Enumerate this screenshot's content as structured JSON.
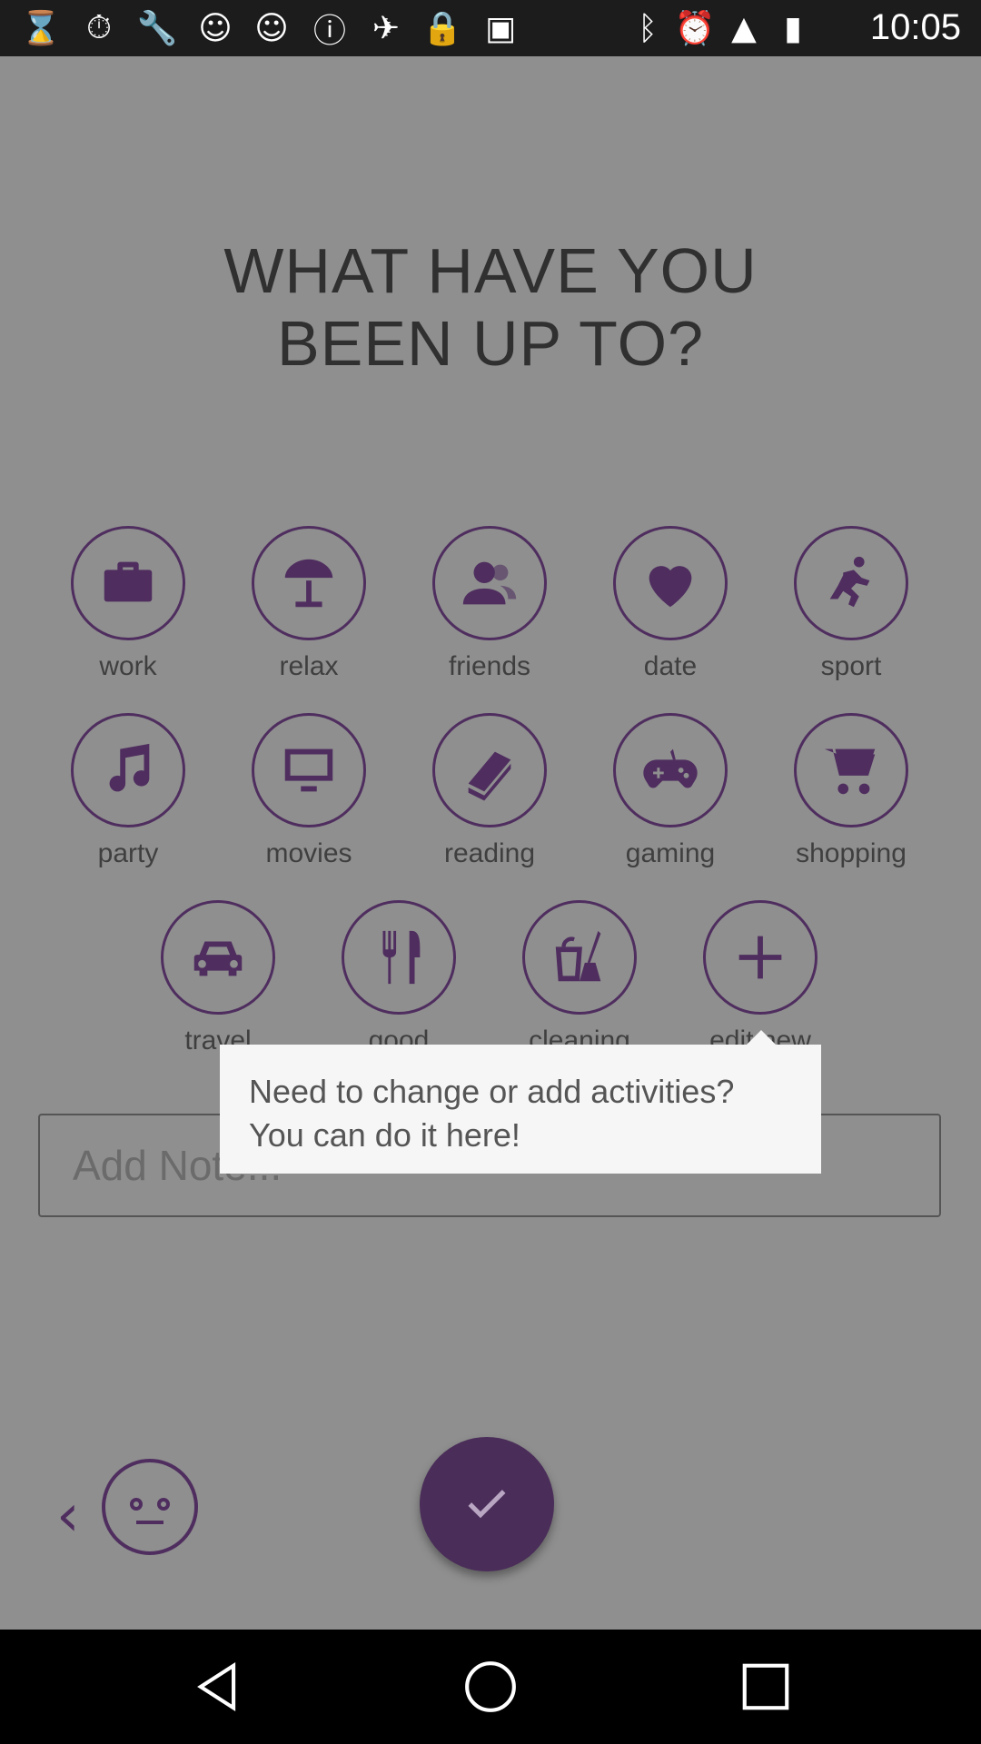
{
  "status_bar": {
    "time": "10:05",
    "icons": [
      "hourglass-icon",
      "stopwatch-icon",
      "wrench-icon",
      "smiley-icon",
      "smiley-icon",
      "info-icon",
      "satellite-icon",
      "lock-icon",
      "android-icon",
      "bluetooth-icon",
      "alarm-icon",
      "signal-icon",
      "battery-icon"
    ]
  },
  "title": {
    "line1": "WHAT HAVE YOU",
    "line2": "BEEN UP TO?"
  },
  "activities": [
    {
      "label": "work",
      "icon": "briefcase-icon"
    },
    {
      "label": "relax",
      "icon": "umbrella-icon"
    },
    {
      "label": "friends",
      "icon": "friends-icon"
    },
    {
      "label": "date",
      "icon": "heart-icon"
    },
    {
      "label": "sport",
      "icon": "runner-icon"
    },
    {
      "label": "party",
      "icon": "music-note-icon"
    },
    {
      "label": "movies",
      "icon": "monitor-icon"
    },
    {
      "label": "reading",
      "icon": "book-icon"
    },
    {
      "label": "gaming",
      "icon": "gamepad-icon"
    },
    {
      "label": "shopping",
      "icon": "cart-icon"
    },
    {
      "label": "travel",
      "icon": "car-icon"
    },
    {
      "label": "good meal",
      "icon": "cutlery-icon"
    },
    {
      "label": "cleaning",
      "icon": "cleaning-icon"
    },
    {
      "label": "edit new",
      "icon": "plus-icon"
    }
  ],
  "note": {
    "placeholder": "Add Note..."
  },
  "tooltip": {
    "line1": "Need to change or add activities?",
    "line2": "You can do it here!"
  },
  "colors": {
    "accent": "#4f2e5f",
    "overlay": "#8f8f8f",
    "tooltip_bg": "#f6f6f6"
  }
}
